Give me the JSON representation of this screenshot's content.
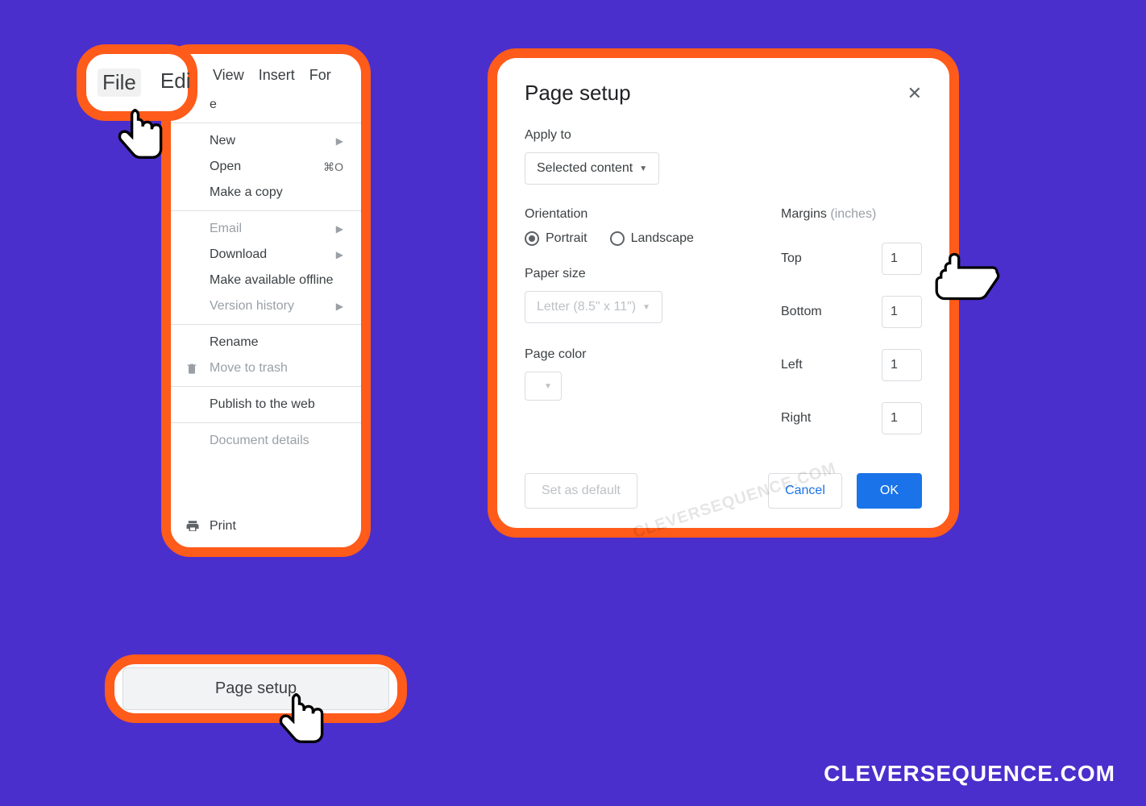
{
  "menubar": {
    "file": "File",
    "edit": "Edi",
    "view": "View",
    "insert": "Insert",
    "format": "For"
  },
  "file_menu": {
    "truncated": "e",
    "new": "New",
    "open": "Open",
    "open_shortcut": "⌘O",
    "make_copy": "Make a copy",
    "email": "Email",
    "download": "Download",
    "offline": "Make available offline",
    "version_history": "Version history",
    "rename": "Rename",
    "move_trash": "Move to trash",
    "publish": "Publish to the web",
    "doc_details": "Document details",
    "page_setup": "Page setup",
    "print": "Print"
  },
  "dialog": {
    "title": "Page setup",
    "apply_to_label": "Apply to",
    "apply_to_value": "Selected content",
    "orientation_label": "Orientation",
    "portrait": "Portrait",
    "landscape": "Landscape",
    "paper_size_label": "Paper size",
    "paper_size_value": "Letter (8.5\" x 11\")",
    "page_color_label": "Page color",
    "margins_label": "Margins",
    "margins_unit": "(inches)",
    "top": "Top",
    "bottom": "Bottom",
    "left": "Left",
    "right": "Right",
    "top_val": "1",
    "bottom_val": "1",
    "left_val": "1",
    "right_val": "1",
    "set_default": "Set as default",
    "cancel": "Cancel",
    "ok": "OK"
  },
  "watermark": "CLEVERSEQUENCE.COM",
  "brand": "CLEVERSEQUENCE.COM"
}
